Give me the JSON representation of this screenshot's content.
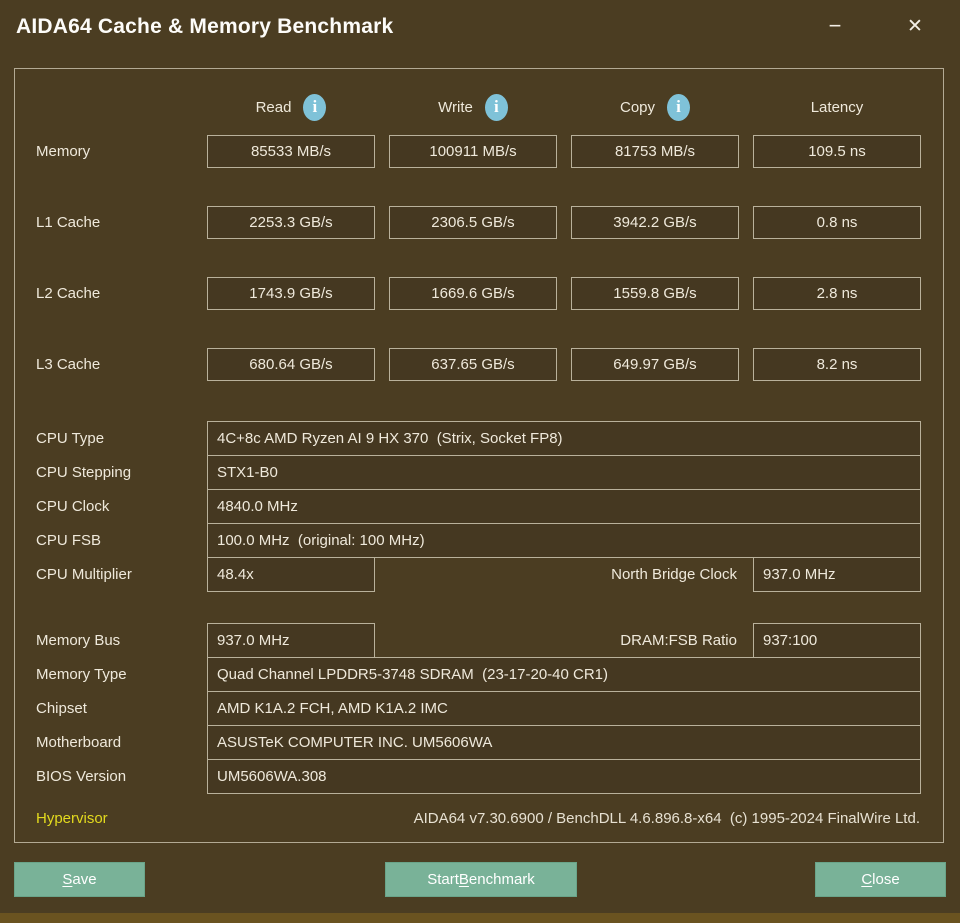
{
  "window": {
    "title": "AIDA64 Cache & Memory Benchmark",
    "controls": {
      "minimize_glyph": "−",
      "close_glyph": "✕"
    }
  },
  "colors": {
    "background_brown": "#4b3d22",
    "box_fill": "#453821",
    "box_border": "#b9b19b",
    "info_icon_blue": "#7fc2d8",
    "button_teal": "#79b298",
    "hypervisor_yellow": "#e3da1e"
  },
  "benchmark": {
    "info_icon_glyph": "i",
    "columns": [
      {
        "label": "Read",
        "has_info_icon": true
      },
      {
        "label": "Write",
        "has_info_icon": true
      },
      {
        "label": "Copy",
        "has_info_icon": true
      },
      {
        "label": "Latency",
        "has_info_icon": false
      }
    ],
    "rows": [
      {
        "label": "Memory",
        "read": "85533 MB/s",
        "write": "100911 MB/s",
        "copy": "81753 MB/s",
        "latency": "109.5 ns"
      },
      {
        "label": "L1 Cache",
        "read": "2253.3 GB/s",
        "write": "2306.5 GB/s",
        "copy": "3942.2 GB/s",
        "latency": "0.8 ns"
      },
      {
        "label": "L2 Cache",
        "read": "1743.9 GB/s",
        "write": "1669.6 GB/s",
        "copy": "1559.8 GB/s",
        "latency": "2.8 ns"
      },
      {
        "label": "L3 Cache",
        "read": "680.64 GB/s",
        "write": "637.65 GB/s",
        "copy": "649.97 GB/s",
        "latency": "8.2 ns"
      }
    ]
  },
  "system": {
    "cpu_type": {
      "label": "CPU Type",
      "value": "4C+8c AMD Ryzen AI 9 HX 370  (Strix, Socket FP8)"
    },
    "cpu_stepping": {
      "label": "CPU Stepping",
      "value": "STX1-B0"
    },
    "cpu_clock": {
      "label": "CPU Clock",
      "value": "4840.0 MHz"
    },
    "cpu_fsb": {
      "label": "CPU FSB",
      "value": "100.0 MHz  (original: 100 MHz)"
    },
    "cpu_multiplier": {
      "label": "CPU Multiplier",
      "value": "48.4x"
    },
    "north_bridge_clock": {
      "label": "North Bridge Clock",
      "value": "937.0 MHz"
    },
    "memory_bus": {
      "label": "Memory Bus",
      "value": "937.0 MHz"
    },
    "dram_fsb_ratio": {
      "label": "DRAM:FSB Ratio",
      "value": "937:100"
    },
    "memory_type": {
      "label": "Memory Type",
      "value": "Quad Channel LPDDR5-3748 SDRAM  (23-17-20-40 CR1)"
    },
    "chipset": {
      "label": "Chipset",
      "value": "AMD K1A.2 FCH, AMD K1A.2 IMC"
    },
    "motherboard": {
      "label": "Motherboard",
      "value": "ASUSTeK COMPUTER INC. UM5606WA"
    },
    "bios_version": {
      "label": "BIOS Version",
      "value": "UM5606WA.308"
    }
  },
  "footer": {
    "hypervisor_label": "Hypervisor",
    "version_line": "AIDA64 v7.30.6900 / BenchDLL 4.6.896.8-x64  (c) 1995-2024 FinalWire Ltd.",
    "buttons": [
      {
        "label": "Save",
        "mnemonic": "S"
      },
      {
        "label": "Start Benchmark",
        "mnemonic": "B"
      },
      {
        "label": "Close",
        "mnemonic": "C"
      }
    ]
  }
}
